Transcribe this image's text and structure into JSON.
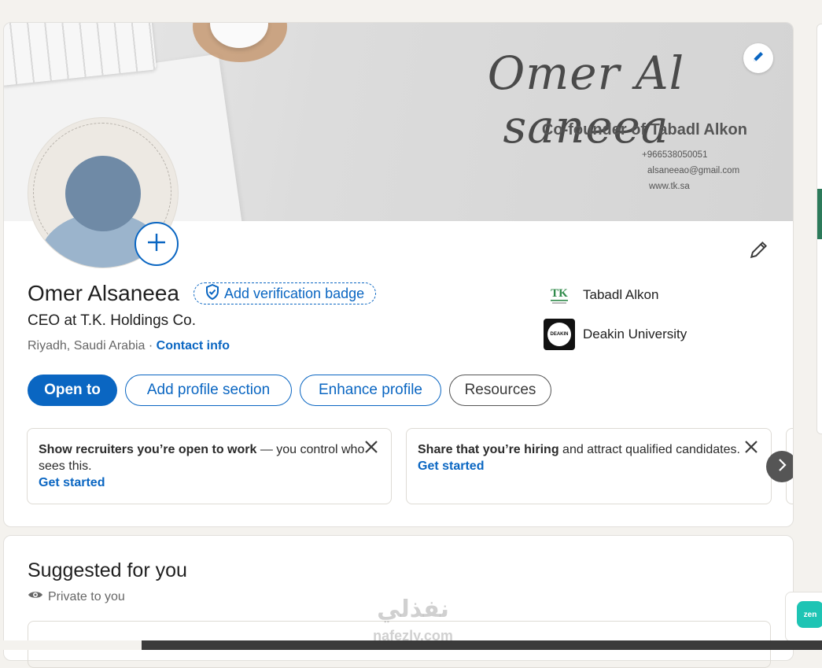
{
  "banner": {
    "name": "Omer Al saneea",
    "subtitle": "Co-founder of Tabadl Alkon",
    "phone": "+966538050051",
    "email": "alsaneeao@gmail.com",
    "website": "www.tk.sa"
  },
  "profile": {
    "name": "Omer Alsaneea",
    "verify_label": "Add verification badge",
    "headline": "CEO at T.K. Holdings Co.",
    "location": "Riyadh, Saudi Arabia",
    "location_sep": " · ",
    "contact_label": "Contact info"
  },
  "orgs": [
    {
      "name": "Tabadl Alkon",
      "logo_text": "TK"
    },
    {
      "name": "Deakin University",
      "logo_text": "DEAKIN"
    }
  ],
  "actions": {
    "open_to": "Open to",
    "add_section": "Add profile section",
    "enhance": "Enhance profile",
    "resources": "Resources"
  },
  "promos": [
    {
      "bold": "Show recruiters you’re open to work",
      "rest": " — you control who sees this.",
      "link": "Get started"
    },
    {
      "bold": "Share that you’re hiring",
      "rest": " and attract qualified candidates.",
      "link": "Get started"
    }
  ],
  "suggested": {
    "title": "Suggested for you",
    "privacy": "Private to you"
  },
  "extension": {
    "label": "zen"
  },
  "watermark": {
    "arabic": "نفذلي",
    "latin": "nafezly.com"
  },
  "colors": {
    "accent": "#0a66c2",
    "avatar_head": "#6f8aa6",
    "avatar_body": "#9bb4cc"
  },
  "icons": [
    "pencil-icon",
    "plus-icon",
    "shield-check-icon",
    "close-icon",
    "chevron-right-icon",
    "eye-icon"
  ]
}
